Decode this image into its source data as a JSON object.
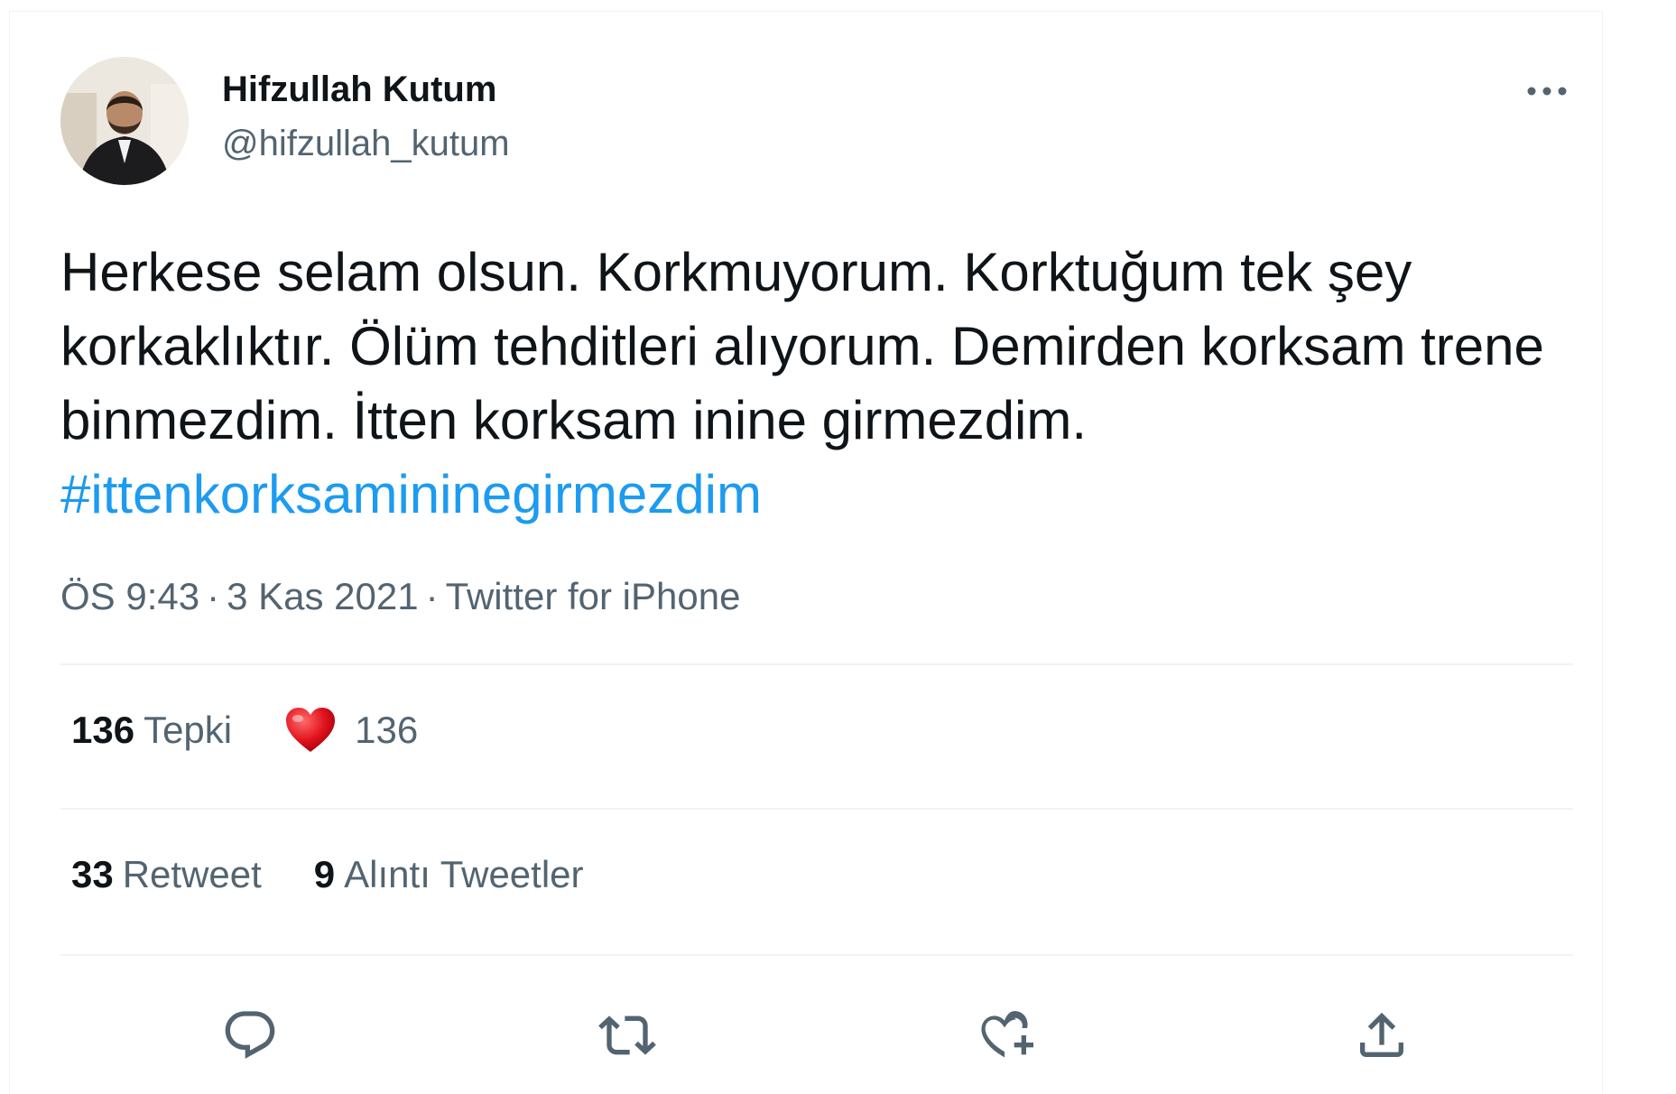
{
  "tweet": {
    "author": {
      "display_name": "Hifzullah Kutum",
      "handle": "@hifzullah_kutum"
    },
    "text_plain": "Herkese selam olsun. Korkmuyorum. Korktuğum tek şey korkaklıktır. Ölüm tehditleri alıyorum. Demirden korksam trene binmezdim. İtten korksam inine girmezdim.",
    "hashtag": "#ittenkorksamininegirmezdim",
    "time": "ÖS 9:43",
    "date": "3 Kas 2021",
    "source": "Twitter for iPhone",
    "separator": "·"
  },
  "reactions": {
    "count": "136",
    "label": "Tepki",
    "heart_count": "136",
    "heart_icon": "red-heart-emoji"
  },
  "retweets": {
    "count": "33",
    "label": "Retweet"
  },
  "quotes": {
    "count": "9",
    "label": "Alıntı Tweetler"
  },
  "actions": {
    "reply_icon": "reply-icon",
    "retweet_icon": "retweet-icon",
    "like_icon": "like-icon",
    "share_icon": "share-icon",
    "more_icon": "more-icon"
  },
  "colors": {
    "hashtag": "#1d9bf0",
    "secondary_text": "#536471",
    "primary_text": "#0f1419",
    "divider": "#eff3f4",
    "heart": "#e0245e"
  }
}
